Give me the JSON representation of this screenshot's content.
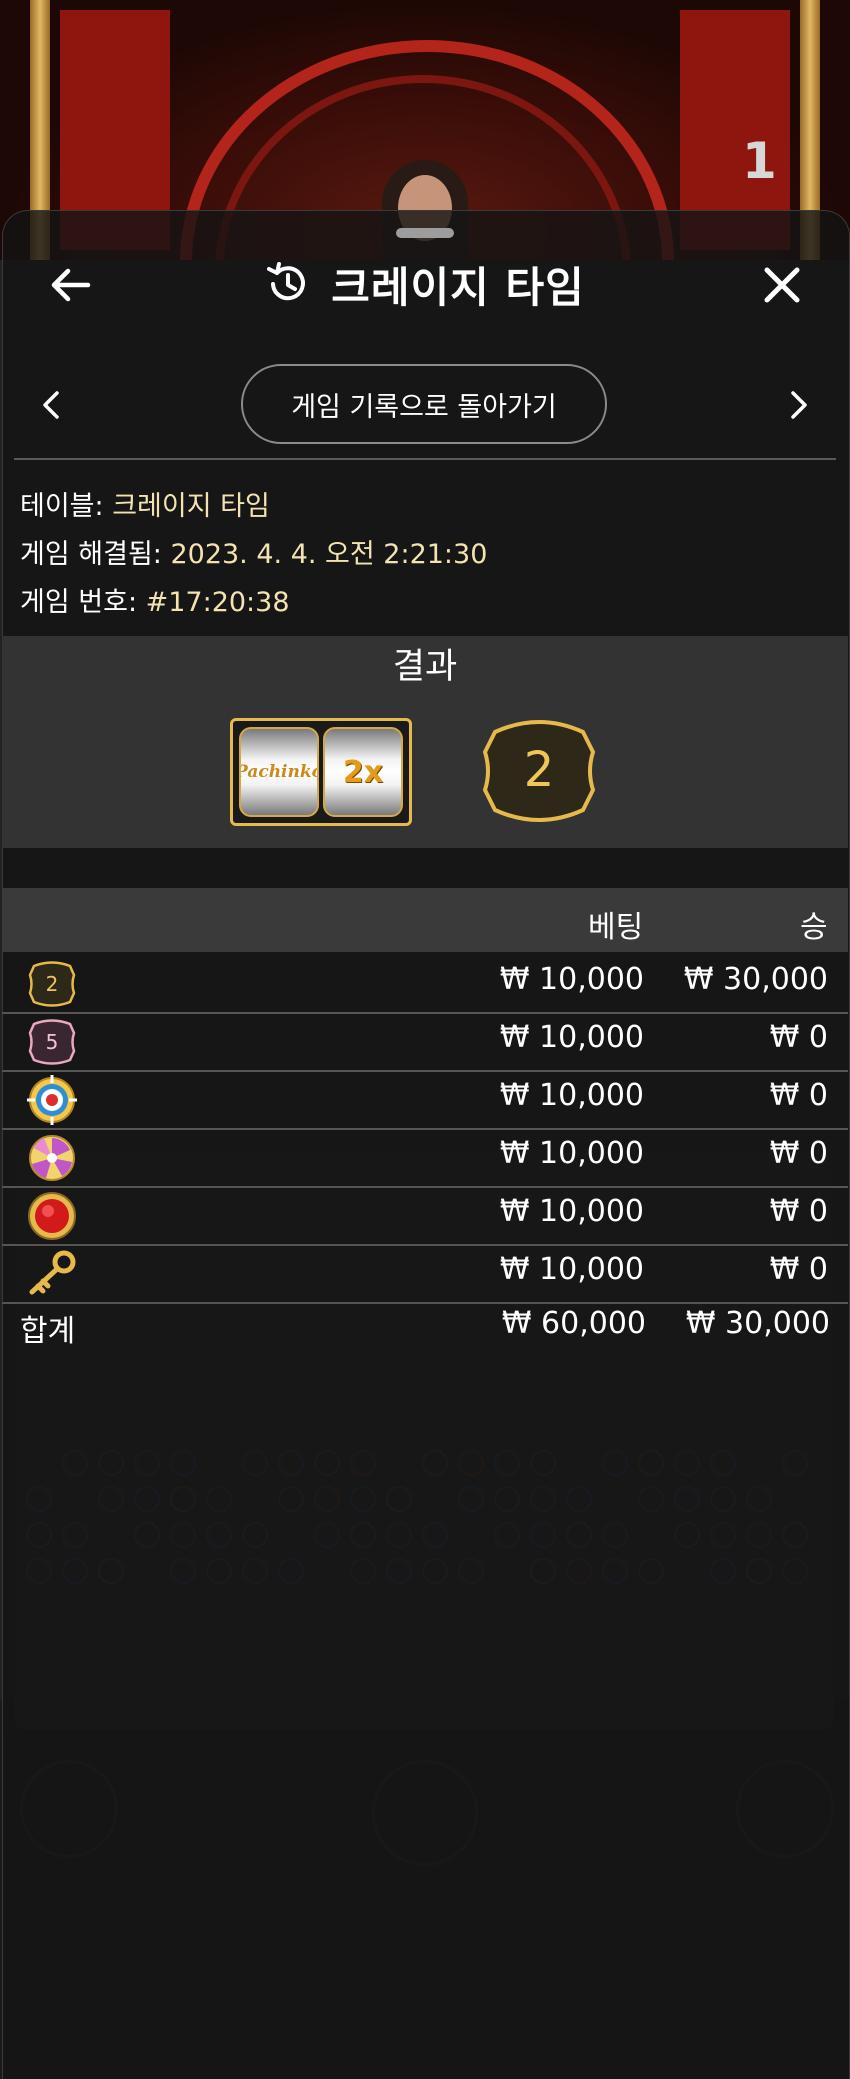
{
  "video": {
    "corner_number": "1"
  },
  "header": {
    "title": "크레이지 타임"
  },
  "navigation": {
    "back_to_history_label": "게임 기록으로 돌아가기"
  },
  "info": {
    "table_label": "테이블: ",
    "table_value": "크레이지 타임",
    "resolved_label": "게임 해결됨: ",
    "resolved_value": "2023. 4. 4. 오전 2:21:30",
    "number_label": "게임 번호: ",
    "number_value": "#17:20:38"
  },
  "result": {
    "title": "결과",
    "slot_left": "Pachinko",
    "slot_right": "2x",
    "segment": "2"
  },
  "bets_table": {
    "col_bet": "베팅",
    "col_win": "승",
    "rows": [
      {
        "spot": "2",
        "icon": "number-2-badge-icon",
        "bet": "₩ 10,000",
        "win": "₩ 30,000"
      },
      {
        "spot": "5",
        "icon": "number-5-badge-icon",
        "bet": "₩ 10,000",
        "win": "₩ 0"
      },
      {
        "spot": "Cash Hunt",
        "icon": "cash-hunt-target-icon",
        "bet": "₩ 10,000",
        "win": "₩ 0"
      },
      {
        "spot": "Pachinko",
        "icon": "pachinko-swirl-icon",
        "bet": "₩ 10,000",
        "win": "₩ 0"
      },
      {
        "spot": "Crazy Time",
        "icon": "crazy-time-red-button-icon",
        "bet": "₩ 10,000",
        "win": "₩ 0"
      },
      {
        "spot": "Coin Flip",
        "icon": "golden-key-icon",
        "bet": "₩ 10,000",
        "win": "₩ 0"
      }
    ],
    "total_label": "합계",
    "total_bet": "₩ 60,000",
    "total_win": "₩ 30,000"
  },
  "colors": {
    "accent_gold": "#e6b94b",
    "info_value": "#f4e3b0",
    "sheet_bg": "#141414"
  }
}
